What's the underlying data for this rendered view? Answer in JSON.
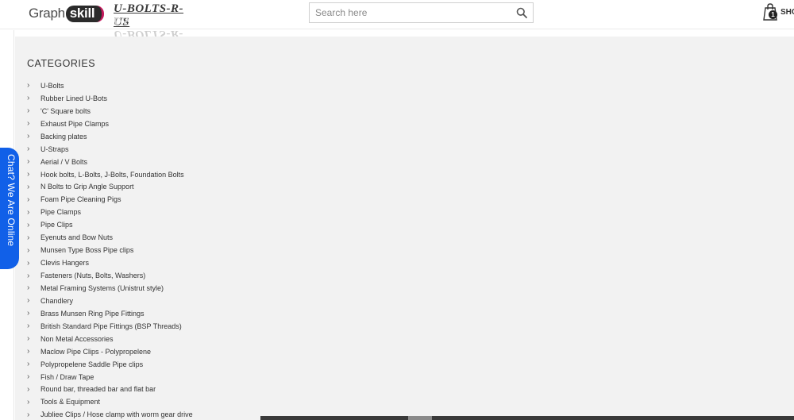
{
  "header": {
    "logo_light": "Graph",
    "logo_bold": "skill",
    "brand_logo": "U-BOLTS-R-US",
    "search": {
      "placeholder": "Search here",
      "icon": "search-icon"
    },
    "cart": {
      "count": "1",
      "label": "SHO"
    }
  },
  "chat": {
    "label": "Chat? We Are Online",
    "color": "#1160e8"
  },
  "categories": {
    "title": "CATEGORIES",
    "items": [
      "U-Bolts",
      "Rubber Lined U-Bots",
      "'C' Square bolts",
      "Exhaust Pipe Clamps",
      "Backing plates",
      "U-Straps",
      "Aerial / V Bolts",
      "Hook bolts, L-Bolts, J-Bolts, Foundation Bolts",
      "N Bolts to Grip Angle Support",
      "Foam Pipe Cleaning Pigs",
      "Pipe Clamps",
      "Pipe Clips",
      "Eyenuts and Bow Nuts",
      "Munsen Type Boss Pipe clips",
      "Clevis Hangers",
      "Fasteners (Nuts, Bolts, Washers)",
      "Metal Framing Systems (Unistrut style)",
      "Chandlery",
      "Brass Munsen Ring Pipe Fittings",
      "British Standard Pipe Fittings (BSP Threads)",
      "Non Metal Accessories",
      "Maclow Pipe Clips - Polypropelene",
      "Polypropelene Saddle Pipe clips",
      "Fish / Draw Tape",
      "Round bar, threaded bar and flat bar",
      "Tools & Equipment",
      "Jubliee Clips / Hose clamp with worm gear drive"
    ]
  }
}
